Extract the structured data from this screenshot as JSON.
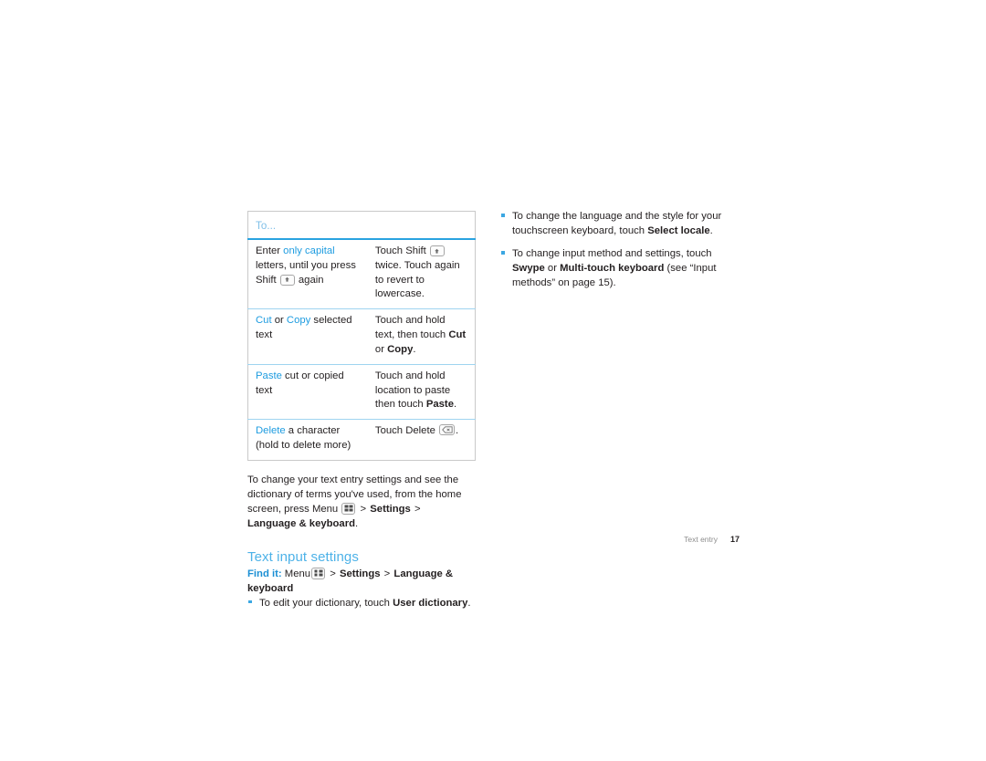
{
  "document": {
    "title": "Text entry",
    "page_number": "17"
  },
  "table": {
    "header_label": "To...",
    "rows": [
      {
        "action": {
          "lead": "Enter",
          "highlight": "only capital",
          "tail_1": " letters, until you press Shift ",
          "icon": "shift-key-icon",
          "tail_2": " again"
        },
        "instruction": {
          "pre": "Touch Shift ",
          "icon": "shift-key-icon",
          "post": " twice. Touch again to revert to lowercase."
        }
      },
      {
        "action": {
          "highlight": "Cut",
          "mid": " or ",
          "highlight2": "Copy",
          "tail_1": " selected text"
        },
        "instruction": {
          "pre": "Touch and hold text, then touch ",
          "bold1": "Cut",
          "mid": " or ",
          "bold2": "Copy",
          "post": "."
        }
      },
      {
        "action": {
          "highlight": "Paste",
          "tail_1": " cut or copied text"
        },
        "instruction": {
          "pre": "Touch and hold location to paste then touch ",
          "bold1": "Paste",
          "post": "."
        }
      },
      {
        "action": {
          "highlight": "Delete",
          "tail_1": " a character (hold to delete more)"
        },
        "instruction": {
          "pre": "Touch Delete ",
          "icon": "delete-key-icon",
          "post": "."
        }
      }
    ]
  },
  "settings_paragraph": {
    "part_1": "To change your text entry settings and see the dictionary of terms you've used, from the home screen, press Menu ",
    "icon": "menu-key-icon",
    "sep_1": ">",
    "bold_1": "Settings",
    "sep_2": ">",
    "bold_2": "Language & keyboard",
    "period": "."
  },
  "section": {
    "heading": "Text input settings",
    "findit": {
      "label": "Find it:",
      "menu_text": "Menu",
      "icon": "menu-key-icon",
      "sep_1": ">",
      "bold_1": "Settings",
      "sep_2": ">",
      "bold_2": "Language & keyboard"
    },
    "bullets": [
      {
        "pre": "To edit your dictionary, touch ",
        "bold": "User dictionary",
        "post": "."
      }
    ]
  },
  "right_column": {
    "bullets": [
      {
        "pre": "To change the language and the style for your touchscreen keyboard, touch ",
        "bold": "Select locale",
        "post": "."
      },
      {
        "pre": "To change input method and settings, touch ",
        "bold": "Swype",
        "mid": " or ",
        "bold2": "Multi-touch keyboard",
        "post": " (see “Input methods” on page 15)."
      }
    ]
  },
  "colors": {
    "accent_blue": "#1e9ce0",
    "heading_blue": "#4db2e8",
    "table_rule_blue": "#9fd4f0",
    "header_rule_blue": "#2aa3e0",
    "table_border_gray": "#c9c9c9",
    "body_text": "#231f20",
    "footer_gray": "#8d8d8d"
  }
}
